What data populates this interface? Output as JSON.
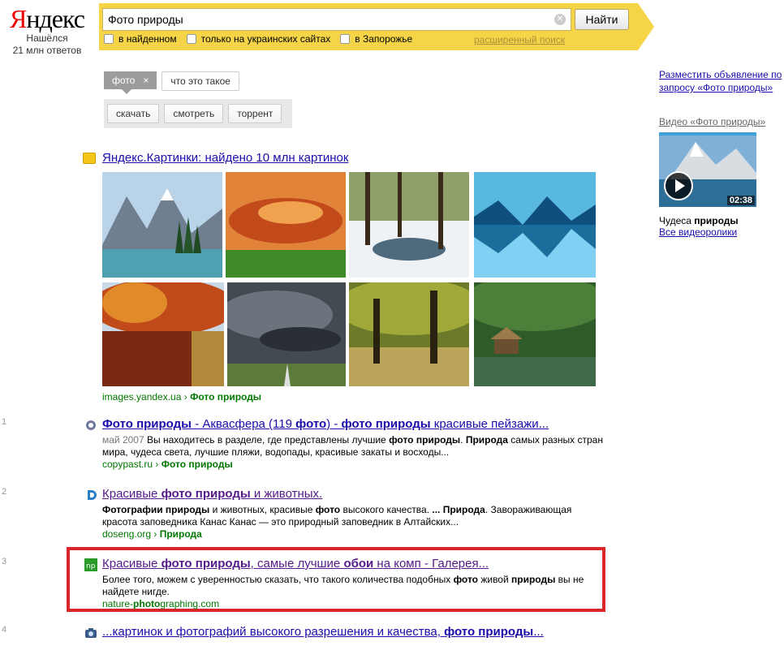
{
  "logo": {
    "text_first": "Я",
    "text_rest": "ндекс",
    "found_line1": "Нашёлся",
    "found_line2": "21 млн ответов"
  },
  "search": {
    "query": "Фото природы",
    "button": "Найти",
    "filters": [
      "в найденном",
      "только на украинских сайтах",
      "в Запорожье"
    ],
    "advanced": "расширенный поиск",
    "accent_color": "#f5d547"
  },
  "tags": {
    "active": "фото",
    "active_close": "×",
    "other": "что это такое",
    "sub": [
      "скачать",
      "смотреть",
      "торрент"
    ]
  },
  "images": {
    "heading": "Яндекс.Картинки: найдено 10 млн картинок",
    "source_host": "images.yandex.ua",
    "source_sep": " › ",
    "source_section": "Фото природы"
  },
  "results": [
    {
      "num": "1",
      "title_parts": [
        {
          "t": "Фото природы",
          "b": true
        },
        {
          "t": " - Аквасфера (119 ",
          "b": false
        },
        {
          "t": "фото",
          "b": true
        },
        {
          "t": ") - ",
          "b": false
        },
        {
          "t": "фото природы",
          "b": true
        },
        {
          "t": " красивые пейзажи...",
          "b": false
        }
      ],
      "snippet_parts": [
        {
          "t": "май 2007 ",
          "b": false,
          "gray": true
        },
        {
          "t": "Вы находитесь в разделе, где представлены лучшие ",
          "b": false
        },
        {
          "t": "фото природы",
          "b": true
        },
        {
          "t": ". ",
          "b": false
        },
        {
          "t": "Природа",
          "b": true
        },
        {
          "t": " самых разных стран мира, чудеса света, лучшие пляжи, водопады, красивые закаты и восходы...",
          "b": false
        }
      ],
      "url_host": "copypast.ru",
      "url_section": "Фото природы",
      "visited": false
    },
    {
      "num": "2",
      "title_parts": [
        {
          "t": "Красивые ",
          "b": false
        },
        {
          "t": "фото природы",
          "b": true
        },
        {
          "t": " и животных.",
          "b": false
        }
      ],
      "snippet_parts": [
        {
          "t": "Фотографии природы",
          "b": true
        },
        {
          "t": " и животных, красивые ",
          "b": false
        },
        {
          "t": "фото",
          "b": true
        },
        {
          "t": " высокого качества. ",
          "b": false
        },
        {
          "t": "... Природа",
          "b": true
        },
        {
          "t": ". Завораживающая красота заповедника Канас Канас — это природный заповедник в Алтайских...",
          "b": false
        }
      ],
      "url_host": "doseng.org",
      "url_section": "Природа",
      "visited": true
    },
    {
      "num": "3",
      "title_parts": [
        {
          "t": "Красивые ",
          "b": false
        },
        {
          "t": "фото природы",
          "b": true
        },
        {
          "t": ", самые лучшие ",
          "b": false
        },
        {
          "t": "обои",
          "b": true
        },
        {
          "t": " на комп - Галерея...",
          "b": false
        }
      ],
      "snippet_parts": [
        {
          "t": "Более того, можем с уверенностью сказать, что такого количества подобных ",
          "b": false
        },
        {
          "t": "фото",
          "b": true
        },
        {
          "t": " живой ",
          "b": false
        },
        {
          "t": "природы",
          "b": true
        },
        {
          "t": " вы не найдете нигде.",
          "b": false
        }
      ],
      "url_host_pre": "nature-",
      "url_host_bold": "photo",
      "url_host_post": "graphing.com",
      "visited": true,
      "highlight_color": "#d9262b"
    },
    {
      "num": "4",
      "title_parts": [
        {
          "t": "...картинок и фотографий высокого разрешения и качества, ",
          "b": false
        },
        {
          "t": "фото природы",
          "b": true
        },
        {
          "t": "...",
          "b": false
        }
      ],
      "visited": false
    }
  ],
  "right": {
    "ad_link": "Разместить объявление по запросу «Фото природы»",
    "video_heading": "Видео «Фото природы»",
    "video_duration": "02:38",
    "video_title_pre": "Чудеса ",
    "video_title_bold": "природы",
    "all_videos": "Все видеоролики"
  }
}
